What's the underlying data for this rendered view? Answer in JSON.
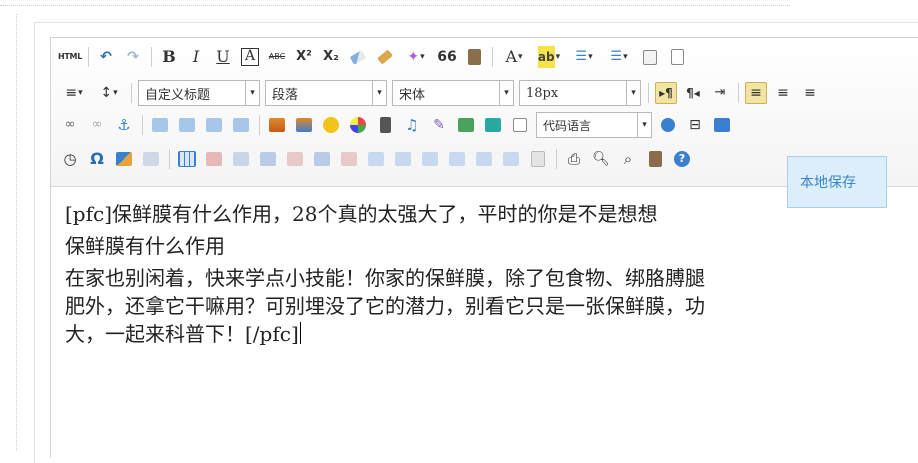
{
  "toolbar": {
    "row1": {
      "html": "HTML",
      "bold": "B",
      "italic": "I",
      "underline": "U",
      "font_border": "A",
      "strike": "ABC",
      "superscript": "X²",
      "subscript": "X₂",
      "blockquote": "66",
      "forecolor": "A",
      "backcolor": "ab"
    },
    "row2": {
      "custom_title": "自定义标题",
      "paragraph": "段落",
      "font_family": "宋体",
      "font_size": "18px"
    },
    "row3": {
      "code_language": "代码语言"
    },
    "row4": {
      "special_char": "Ω"
    }
  },
  "content": {
    "line1": "[pfc]保鲜膜有什么作用，28个真的太强大了，平时的你是不是想想",
    "line2": "保鲜膜有什么作用",
    "line3": "在家也别闲着，快来学点小技能！你家的保鲜膜，除了包食物、绑胳膊腿",
    "line4": "肥外，还拿它干嘛用？可别埋没了它的潜力，别看它只是一张保鲜膜，功",
    "line5": "大，一起来科普下！[/pfc]"
  },
  "local_save_tip": "本地保存"
}
